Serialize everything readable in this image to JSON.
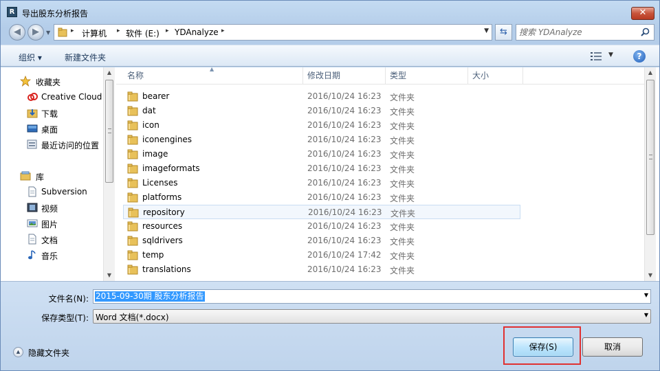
{
  "window": {
    "title": "导出股东分析报告",
    "app_icon_letter": "R",
    "close_glyph": "✕"
  },
  "nav": {
    "back_glyph": "◀",
    "forward_glyph": "▶",
    "dropdown_glyph": "▼",
    "breadcrumbs": [
      "计算机",
      "软件 (E:)",
      "YDAnalyze"
    ],
    "crumb_separator": "▸",
    "refresh_glyph": "⇆",
    "search_placeholder": "搜索 YDAnalyze"
  },
  "toolbar": {
    "organize_label": "组织 ▾",
    "new_folder_label": "新建文件夹",
    "view_dropdown_glyph": "▼",
    "help_glyph": "?"
  },
  "sidebar": {
    "favorites": {
      "label": "收藏夹",
      "icon": "star-icon",
      "items": [
        {
          "label": "Creative Cloud",
          "icon": "creative-cloud-icon"
        },
        {
          "label": "下载",
          "icon": "download-folder-icon"
        },
        {
          "label": "桌面",
          "icon": "desktop-icon"
        },
        {
          "label": "最近访问的位置",
          "icon": "recent-places-icon"
        }
      ]
    },
    "libraries": {
      "label": "库",
      "icon": "library-icon",
      "items": [
        {
          "label": "Subversion",
          "icon": "document-icon"
        },
        {
          "label": "视频",
          "icon": "video-icon"
        },
        {
          "label": "图片",
          "icon": "picture-icon"
        },
        {
          "label": "文档",
          "icon": "document-icon"
        },
        {
          "label": "音乐",
          "icon": "music-icon"
        }
      ]
    }
  },
  "file_list": {
    "columns": [
      "名称",
      "修改日期",
      "类型",
      "大小"
    ],
    "sort_glyph": "▲",
    "selected_index": 8,
    "rows": [
      {
        "name": "bearer",
        "date": "2016/10/24 16:23",
        "type": "文件夹"
      },
      {
        "name": "dat",
        "date": "2016/10/24 16:23",
        "type": "文件夹"
      },
      {
        "name": "icon",
        "date": "2016/10/24 16:23",
        "type": "文件夹"
      },
      {
        "name": "iconengines",
        "date": "2016/10/24 16:23",
        "type": "文件夹"
      },
      {
        "name": "image",
        "date": "2016/10/24 16:23",
        "type": "文件夹"
      },
      {
        "name": "imageformats",
        "date": "2016/10/24 16:23",
        "type": "文件夹"
      },
      {
        "name": "Licenses",
        "date": "2016/10/24 16:23",
        "type": "文件夹"
      },
      {
        "name": "platforms",
        "date": "2016/10/24 16:23",
        "type": "文件夹"
      },
      {
        "name": "repository",
        "date": "2016/10/24 16:23",
        "type": "文件夹"
      },
      {
        "name": "resources",
        "date": "2016/10/24 16:23",
        "type": "文件夹"
      },
      {
        "name": "sqldrivers",
        "date": "2016/10/24 16:23",
        "type": "文件夹"
      },
      {
        "name": "temp",
        "date": "2016/10/24 17:42",
        "type": "文件夹"
      },
      {
        "name": "translations",
        "date": "2016/10/24 16:23",
        "type": "文件夹"
      }
    ]
  },
  "form": {
    "filename_label": "文件名(N):",
    "filename_value": "2015-09-30期 股东分析报告",
    "filetype_label": "保存类型(T):",
    "filetype_value": "Word 文档(*.docx)",
    "combo_drop_glyph": "▼"
  },
  "footer": {
    "hide_folders_label": "隐藏文件夹",
    "hide_folders_glyph": "▲",
    "save_label": "保存(S)",
    "cancel_label": "取消"
  },
  "colors": {
    "highlight": "#e03030",
    "selection": "#3399ff",
    "folder": "#e8c15a"
  }
}
